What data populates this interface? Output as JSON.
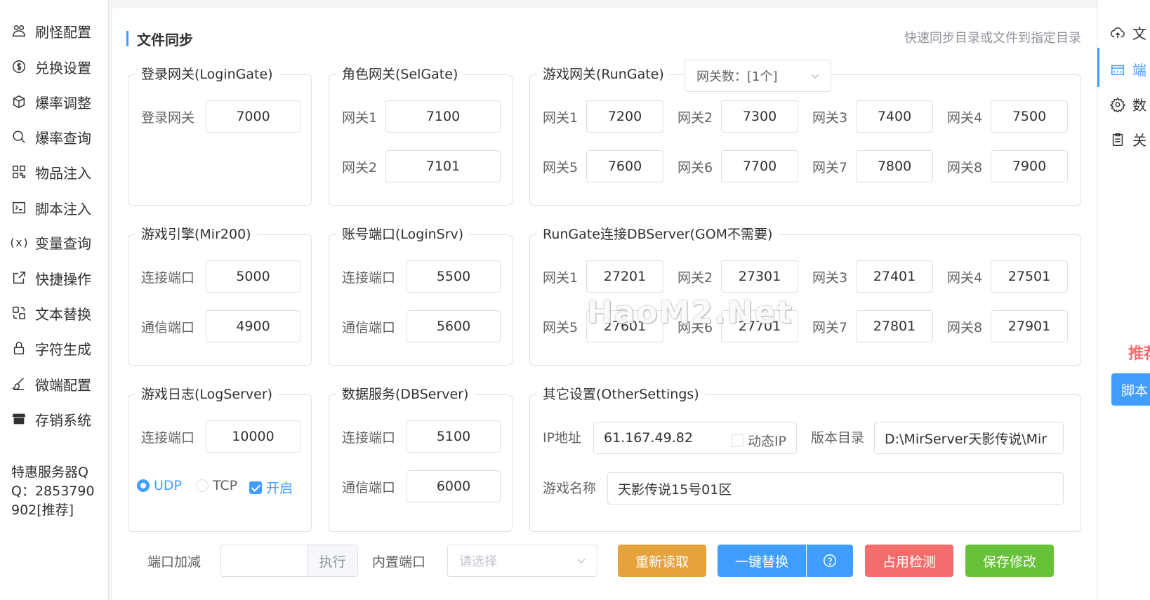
{
  "sidebar": {
    "items": [
      {
        "label": "刷怪配置",
        "icon": "monster-icon"
      },
      {
        "label": "兑换设置",
        "icon": "dollar-icon"
      },
      {
        "label": "爆率调整",
        "icon": "box-icon"
      },
      {
        "label": "爆率查询",
        "icon": "search-icon"
      },
      {
        "label": "物品注入",
        "icon": "qrcode-icon"
      },
      {
        "label": "脚本注入",
        "icon": "terminal-icon"
      },
      {
        "label": "变量查询",
        "icon": "variable-icon"
      },
      {
        "label": "快捷操作",
        "icon": "external-link-icon"
      },
      {
        "label": "文本替换",
        "icon": "replace-icon"
      },
      {
        "label": "字符生成",
        "icon": "lock-icon"
      },
      {
        "label": "微端配置",
        "icon": "brush-icon"
      },
      {
        "label": "存销系统",
        "icon": "store-icon"
      }
    ],
    "server_info": "特惠服务器QQ：2853790902[推荐]"
  },
  "header": {
    "title": "文件同步",
    "subtitle": "快速同步目录或文件到指定目录"
  },
  "groups": {
    "login_gate": {
      "title": "登录网关(LoginGate)",
      "label": "登录网关",
      "value": "7000"
    },
    "sel_gate": {
      "title": "角色网关(SelGate)",
      "items": [
        {
          "label": "网关1",
          "value": "7100"
        },
        {
          "label": "网关2",
          "value": "7101"
        }
      ]
    },
    "run_gate": {
      "title": "游戏网关(RunGate)",
      "select": "网关数：[1个]",
      "items": [
        {
          "label": "网关1",
          "value": "7200"
        },
        {
          "label": "网关2",
          "value": "7300"
        },
        {
          "label": "网关3",
          "value": "7400"
        },
        {
          "label": "网关4",
          "value": "7500"
        },
        {
          "label": "网关5",
          "value": "7600"
        },
        {
          "label": "网关6",
          "value": "7700"
        },
        {
          "label": "网关7",
          "value": "7800"
        },
        {
          "label": "网关8",
          "value": "7900"
        }
      ]
    },
    "mir200": {
      "title": "游戏引擎(Mir200)",
      "items": [
        {
          "label": "连接端口",
          "value": "5000"
        },
        {
          "label": "通信端口",
          "value": "4900"
        }
      ]
    },
    "login_srv": {
      "title": "账号端口(LoginSrv)",
      "items": [
        {
          "label": "连接端口",
          "value": "5500"
        },
        {
          "label": "通信端口",
          "value": "5600"
        }
      ]
    },
    "rungate_db": {
      "title": "RunGate连接DBServer(GOM不需要)",
      "items": [
        {
          "label": "网关1",
          "value": "27201"
        },
        {
          "label": "网关2",
          "value": "27301"
        },
        {
          "label": "网关3",
          "value": "27401"
        },
        {
          "label": "网关4",
          "value": "27501"
        },
        {
          "label": "网关5",
          "value": "27601"
        },
        {
          "label": "网关6",
          "value": "27701"
        },
        {
          "label": "网关7",
          "value": "27801"
        },
        {
          "label": "网关8",
          "value": "27901"
        }
      ]
    },
    "log_server": {
      "title": "游戏日志(LogServer)",
      "label": "连接端口",
      "value": "10000",
      "udp": "UDP",
      "tcp": "TCP",
      "enable": "开启"
    },
    "db_server": {
      "title": "数据服务(DBServer)",
      "items": [
        {
          "label": "连接端口",
          "value": "5100"
        },
        {
          "label": "通信端口",
          "value": "6000"
        }
      ]
    },
    "other": {
      "title": "其它设置(OtherSettings)",
      "ip_label": "IP地址",
      "ip_value": "61.167.49.82",
      "dynamic_ip": "动态IP",
      "version_label": "版本目录",
      "version_value": "D:\\MirServer天影传说\\Mir",
      "name_label": "游戏名称",
      "name_value": "天影传说15号01区"
    }
  },
  "bottom": {
    "port_adjust_label": "端口加减",
    "execute": "执行",
    "builtin_port_label": "内置端口",
    "builtin_placeholder": "请选择",
    "reload": "重新读取",
    "one_click_replace": "一键替换",
    "occupancy_check": "占用检测",
    "save": "保存修改"
  },
  "right_panel": {
    "items": [
      "文",
      "端",
      "数",
      "关"
    ],
    "recommend": "推荐",
    "script_button": "脚本"
  },
  "watermark": "HaoM2.Net"
}
